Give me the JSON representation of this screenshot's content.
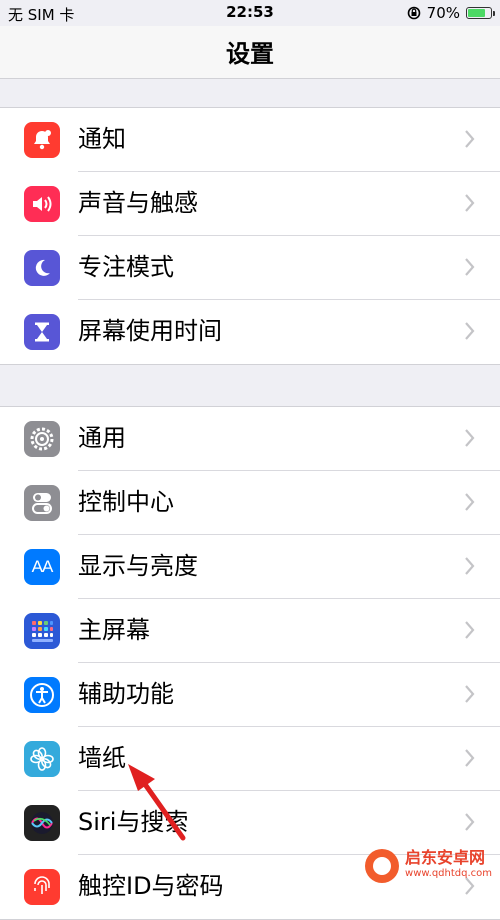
{
  "status_bar": {
    "carrier": "无 SIM 卡",
    "time": "22:53",
    "battery_percent": "70%",
    "battery_level": 0.7
  },
  "nav": {
    "title": "设置"
  },
  "groups": [
    {
      "items": [
        {
          "label": "通知",
          "icon": "bell-icon",
          "color": "#ff3b30"
        },
        {
          "label": "声音与触感",
          "icon": "speaker-icon",
          "color": "#ff2d55"
        },
        {
          "label": "专注模式",
          "icon": "moon-icon",
          "color": "#5856d6"
        },
        {
          "label": "屏幕使用时间",
          "icon": "hourglass-icon",
          "color": "#5856d6"
        }
      ]
    },
    {
      "items": [
        {
          "label": "通用",
          "icon": "gear-icon",
          "color": "#8e8e93"
        },
        {
          "label": "控制中心",
          "icon": "toggles-icon",
          "color": "#8e8e93"
        },
        {
          "label": "显示与亮度",
          "icon": "text-size-icon",
          "color": "#007aff"
        },
        {
          "label": "主屏幕",
          "icon": "home-grid-icon",
          "color": "#2c59d6"
        },
        {
          "label": "辅助功能",
          "icon": "accessibility-icon",
          "color": "#007aff"
        },
        {
          "label": "墙纸",
          "icon": "flower-icon",
          "color": "#34aadc"
        },
        {
          "label": "Siri与搜索",
          "icon": "siri-icon",
          "color": "#222222"
        },
        {
          "label": "触控ID与密码",
          "icon": "fingerprint-icon",
          "color": "#ff3b30"
        }
      ]
    }
  ],
  "icon_glyph": {
    "text_size": "AA"
  },
  "watermark": {
    "name": "启东安卓网",
    "url": "www.qdhtdq.com"
  }
}
